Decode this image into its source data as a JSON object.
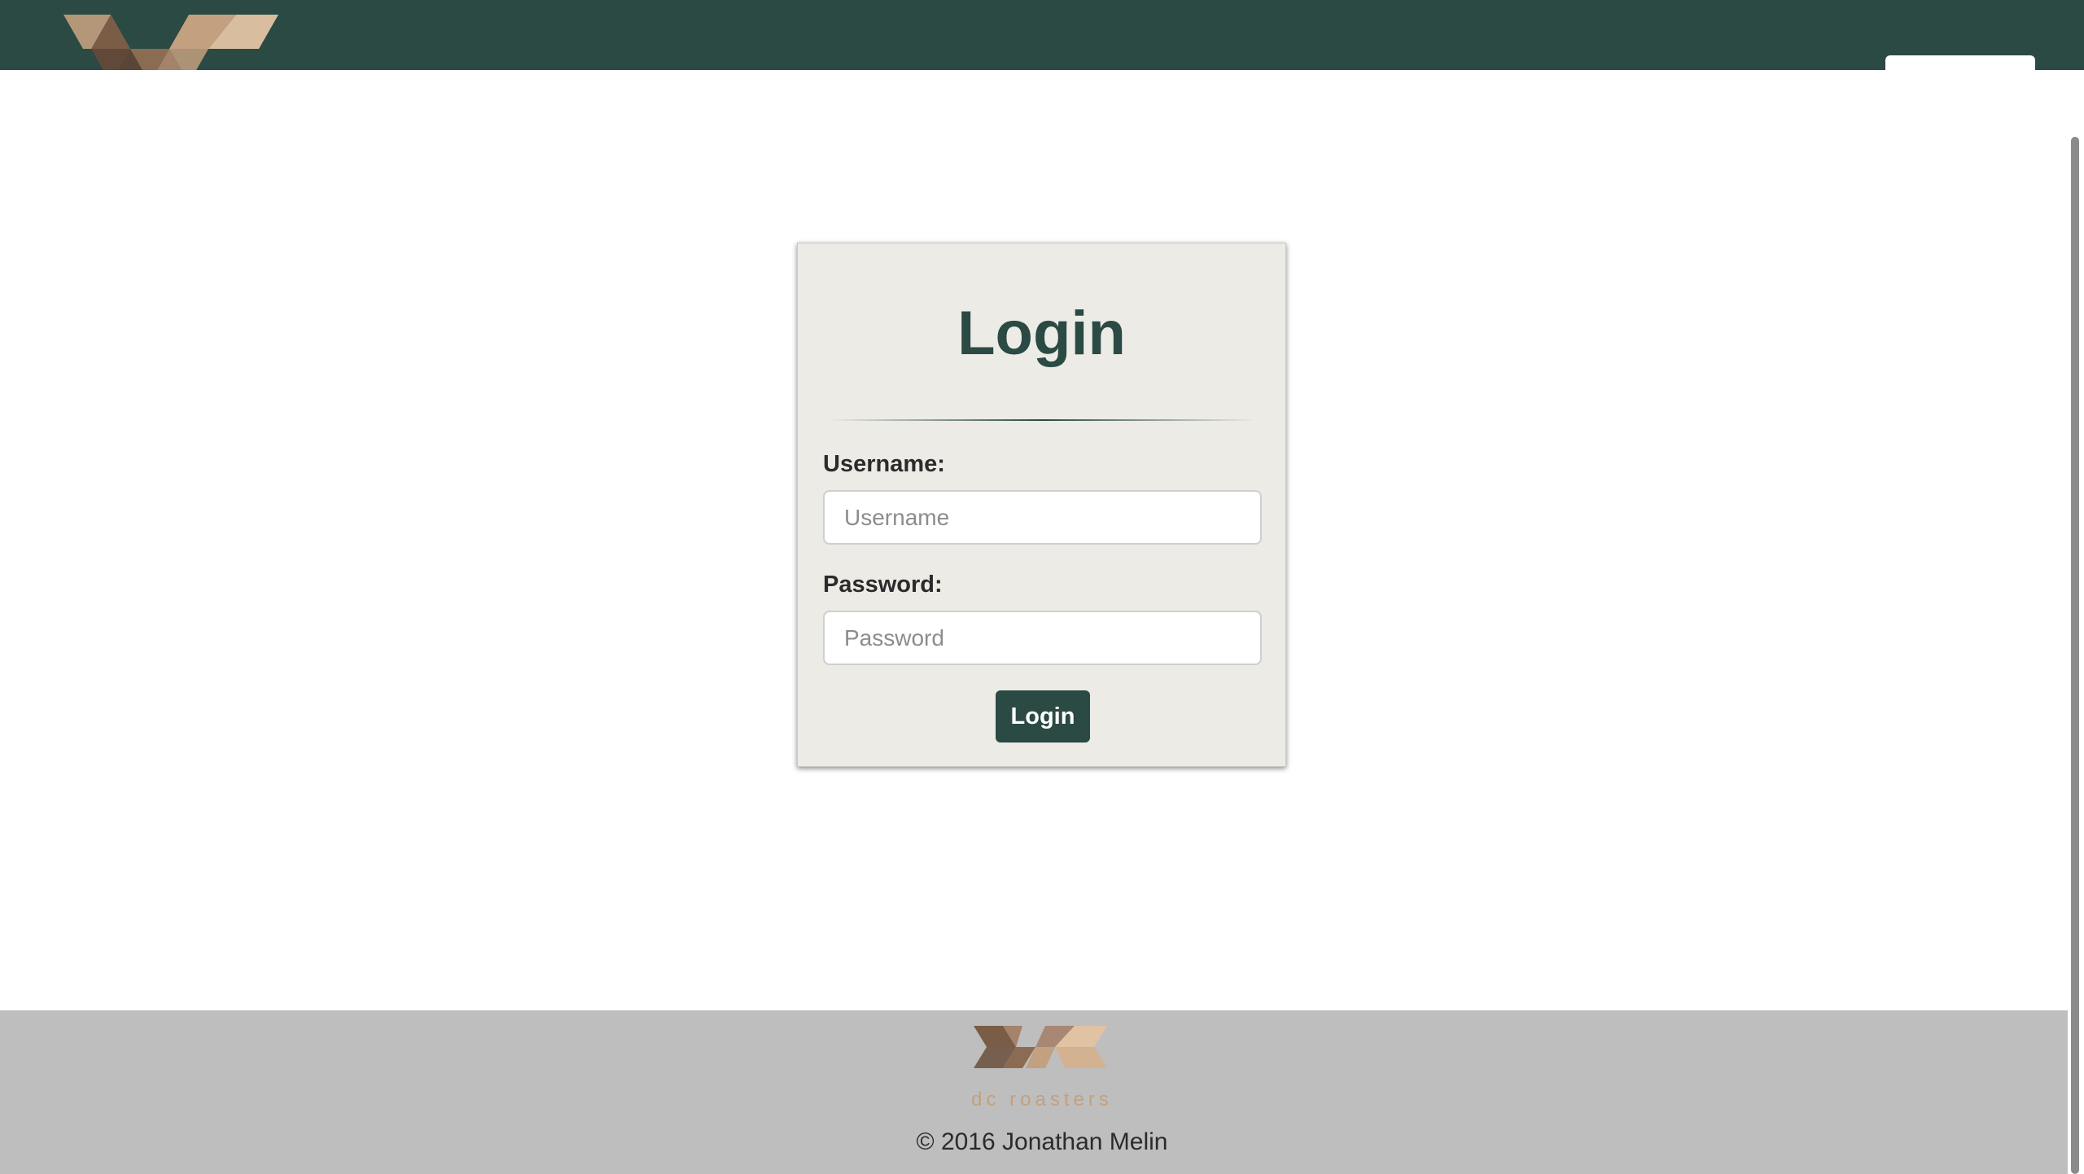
{
  "colors": {
    "brand_dark_green": "#2a4a43",
    "card_background": "#ecebe6",
    "footer_background": "#bebebe",
    "logo_tan": "#c3a07f",
    "logo_brown": "#6e5443"
  },
  "header": {
    "logo_icon": "dc-roasters-logo-icon"
  },
  "login": {
    "title": "Login",
    "username_label": "Username:",
    "username_placeholder": "Username",
    "username_value": "",
    "password_label": "Password:",
    "password_placeholder": "Password",
    "password_value": "",
    "submit_label": "Login"
  },
  "footer": {
    "logo_icon": "dc-roasters-logo-icon",
    "brand_text": "dc roasters",
    "copyright": "© 2016 Jonathan Melin"
  }
}
